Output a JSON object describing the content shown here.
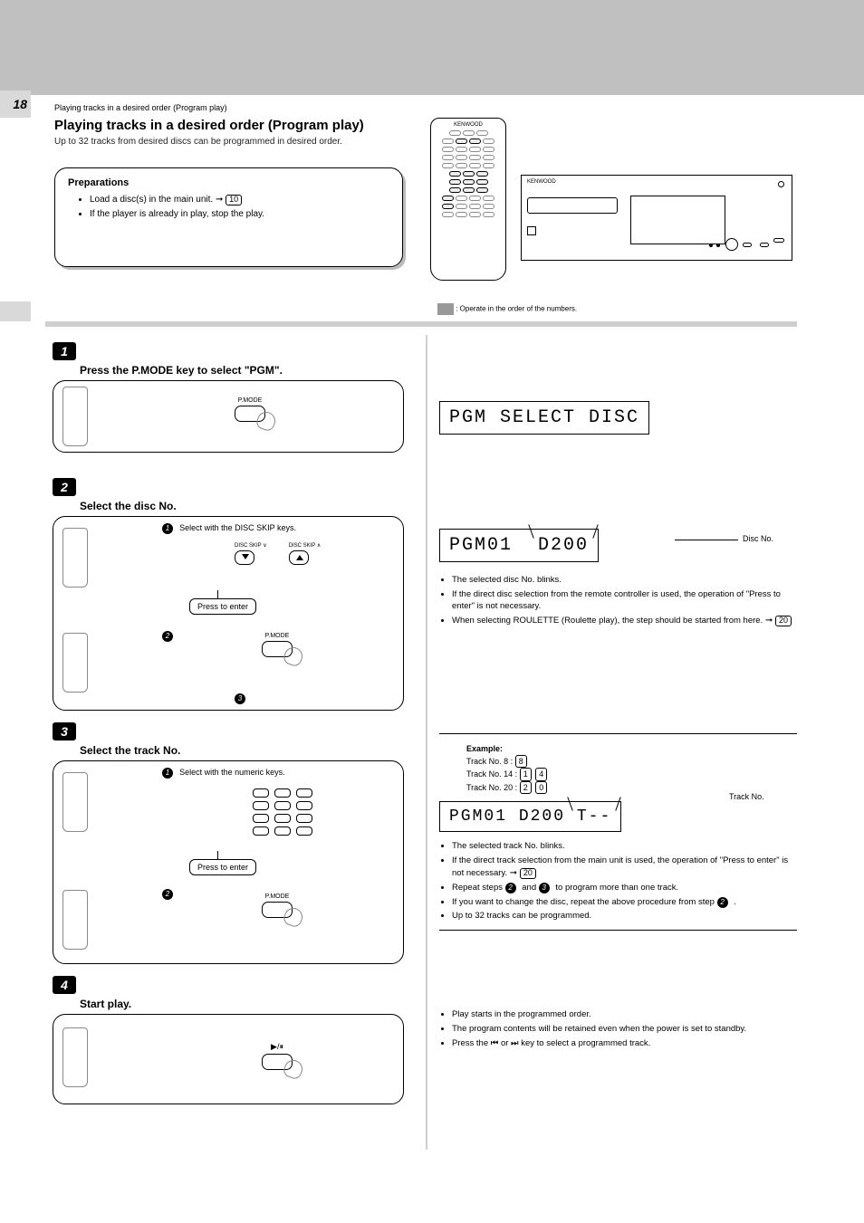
{
  "page_number": "18",
  "header_title": "Playing tracks in a desired order (Program play)",
  "header_sub": "Up to 32 tracks from desired discs can be programmed in desired order.",
  "prepare": {
    "heading": "Preparations",
    "items": [
      {
        "text": "Load a disc(s) in the main unit.",
        "ref": "10"
      },
      {
        "text": "If the player is already in play, stop the play."
      }
    ]
  },
  "mode_label": ": Operate in the order of the numbers.",
  "steps": {
    "s1": {
      "title": "Press the P.MODE key to select \"PGM\".",
      "btn_label": "P.MODE",
      "lcd": "PGM SELECT DISC"
    },
    "s2": {
      "title": "Select the disc No.",
      "sub1": "Select with the DISC SKIP keys.",
      "skip_down": "DISC SKIP ∨",
      "skip_up": "DISC SKIP ∧",
      "enter_sub": "Press to enter",
      "sub2_label": "P.MODE",
      "lcd_prefix": "PGM01",
      "lcd_disc": "D200",
      "disc_annot": "Disc No.",
      "bullets": [
        "The selected disc No. blinks.",
        "If the direct disc selection from the remote controller is used, the operation of \"Press to enter\" is not necessary.",
        "When selecting ROULETTE (Roulette play), the step should be started from here."
      ],
      "ref": "20"
    },
    "s3": {
      "title": "Select the track No.",
      "sub1": "Select with the numeric keys.",
      "enter_sub": "Press to enter",
      "sub2_label": "P.MODE",
      "example_heading": "Example:",
      "examples": [
        {
          "label": "Track No. 8 :",
          "keys": [
            "8"
          ]
        },
        {
          "label": "Track No. 14 :",
          "keys": [
            "1",
            "4"
          ]
        },
        {
          "label": "Track No. 20 :",
          "keys": [
            "2",
            "0"
          ]
        }
      ],
      "lcd_prefix": "PGM01",
      "lcd_disc": "D200",
      "lcd_track_dash": "T--",
      "track_annot": "Track No.",
      "bullets1": [
        "The selected track No. blinks.",
        "If the direct track selection from the main unit is used, the operation of \"Press to enter\" is not necessary."
      ],
      "ref": "20",
      "bullets2": [
        {
          "text": "Repeat steps ",
          "suffix": " to program more than one track.",
          "badges": [
            "2",
            "3"
          ]
        },
        {
          "text": "If you want to change the disc, repeat the above procedure from step ",
          "badges": [
            "2"
          ],
          "period": "."
        },
        {
          "text": "Up to 32 tracks can be programmed."
        }
      ]
    },
    "s4": {
      "title": "Start play.",
      "btn_icon": "▶/⏸",
      "bullets": [
        "Play starts in the programmed order.",
        "The program contents will be retained even when the power is set to standby.",
        "Press the ⏮ or ⏭ key to select a programmed track."
      ]
    }
  },
  "section_label": "Playing tracks in a desired order (Program play)"
}
